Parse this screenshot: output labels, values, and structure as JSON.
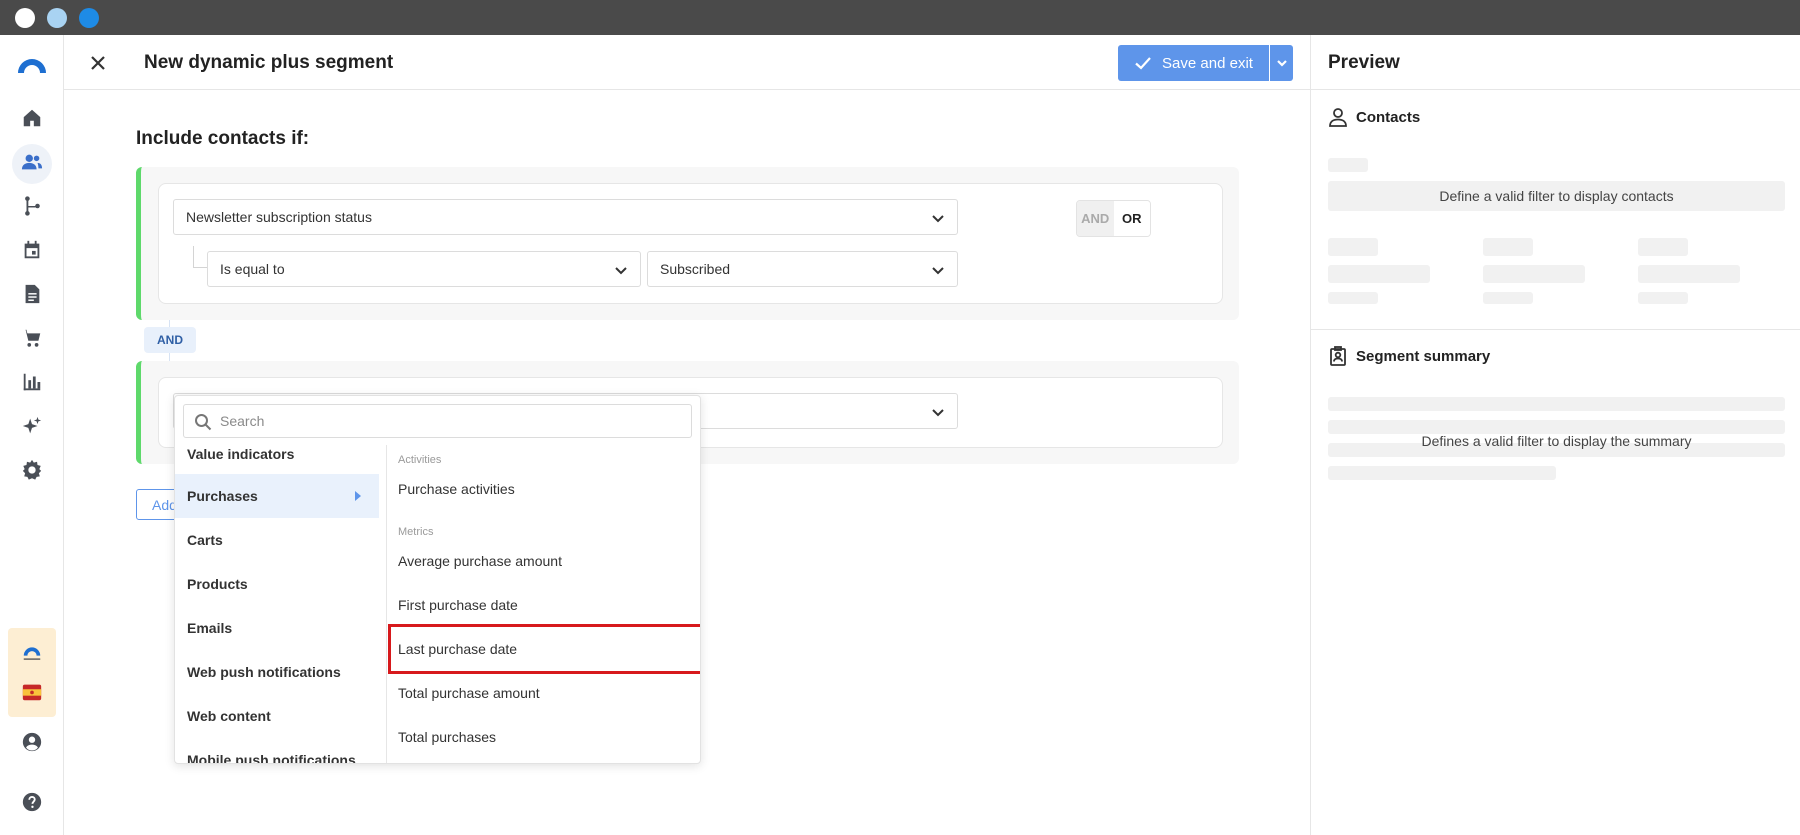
{
  "page": {
    "title": "New dynamic plus segment"
  },
  "toolbar": {
    "save_label": "Save and exit"
  },
  "main": {
    "include_title": "Include contacts if:",
    "group1": {
      "attribute": "Newsletter subscription status",
      "operator": "Is equal to",
      "value": "Subscribed",
      "and_label": "AND",
      "or_label": "OR"
    },
    "and_connector": "AND",
    "add_button": "Add"
  },
  "dropdown": {
    "search_placeholder": "Search",
    "categories": [
      "Value indicators",
      "Purchases",
      "Carts",
      "Products",
      "Emails",
      "Web push notifications",
      "Web content",
      "Mobile push notifications"
    ],
    "selected_category": "Purchases",
    "sections": [
      {
        "title": "Activities",
        "options": [
          "Purchase activities"
        ]
      },
      {
        "title": "Metrics",
        "options": [
          "Average purchase amount",
          "First purchase date",
          "Last purchase date",
          "Total purchase amount",
          "Total purchases"
        ]
      }
    ],
    "highlighted_option": "Last purchase date"
  },
  "preview": {
    "title": "Preview",
    "contacts_title": "Contacts",
    "contacts_message": "Define a valid filter to display contacts",
    "summary_title": "Segment summary",
    "summary_message": "Defines a valid filter to display the summary"
  },
  "colors": {
    "accent": "#5e95ea",
    "group_border": "#5ed96b",
    "highlight": "#d7191c",
    "titlebar": "#4a4a4a"
  },
  "icons": {
    "sidebar": [
      "logo-icon",
      "home-icon",
      "contacts-icon",
      "automation-icon",
      "calendar-icon",
      "document-icon",
      "cart-icon",
      "analytics-icon",
      "ai-sparkle-icon",
      "settings-icon",
      "account-icon",
      "help-icon"
    ]
  }
}
